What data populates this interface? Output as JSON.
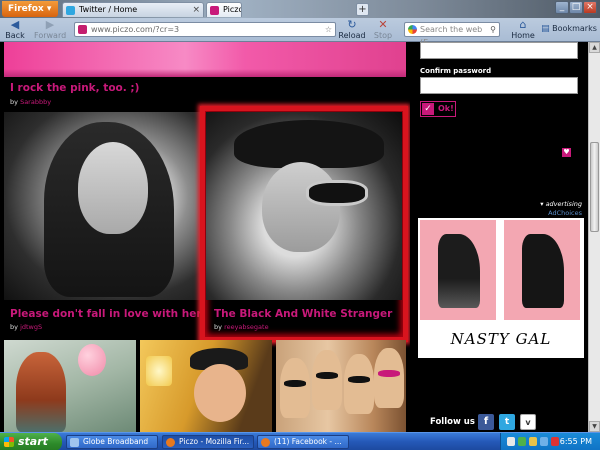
{
  "browser": {
    "menu_label": "Firefox",
    "tabs": [
      {
        "label": "Twitter / Home"
      },
      {
        "label": "Piczo"
      }
    ],
    "new_tab": "+",
    "nav": {
      "back": "Back",
      "forward": "Forward",
      "reload": "Reload",
      "stop": "Stop",
      "home": "Home",
      "bookmarks": "Bookmarks"
    },
    "url": "www.piczo.com/?cr=3",
    "search_placeholder": "Search the web (E...",
    "colors": {
      "firefox_orange": "#e8791f",
      "accent": "#c8197a"
    }
  },
  "page": {
    "top_post": {
      "title": "I rock the pink, too. ;)",
      "by": "by",
      "user": "Sarabbby"
    },
    "cards": [
      {
        "title": "Please don't fall in love with her.",
        "by": "by",
        "user": "jdtwgS"
      },
      {
        "title": "The Black And White Stranger",
        "by": "by",
        "user": "reeyabsegate"
      }
    ]
  },
  "sidebar": {
    "confirm_label": "Confirm password",
    "ok_label": "Ok!",
    "ad_label": "advertising",
    "adchoices": "AdChoices",
    "ad_brand": "NASTY GAL",
    "follow_label": "Follow us",
    "facebook_glyph": "f",
    "twitter_glyph": "t",
    "more_glyph": "v"
  },
  "taskbar": {
    "start": "start",
    "tasks": [
      {
        "label": "Globe Broadband"
      },
      {
        "label": "Piczo - Mozilla Fir..."
      },
      {
        "label": "(11) Facebook - ..."
      }
    ],
    "clock": "6:55 PM"
  }
}
